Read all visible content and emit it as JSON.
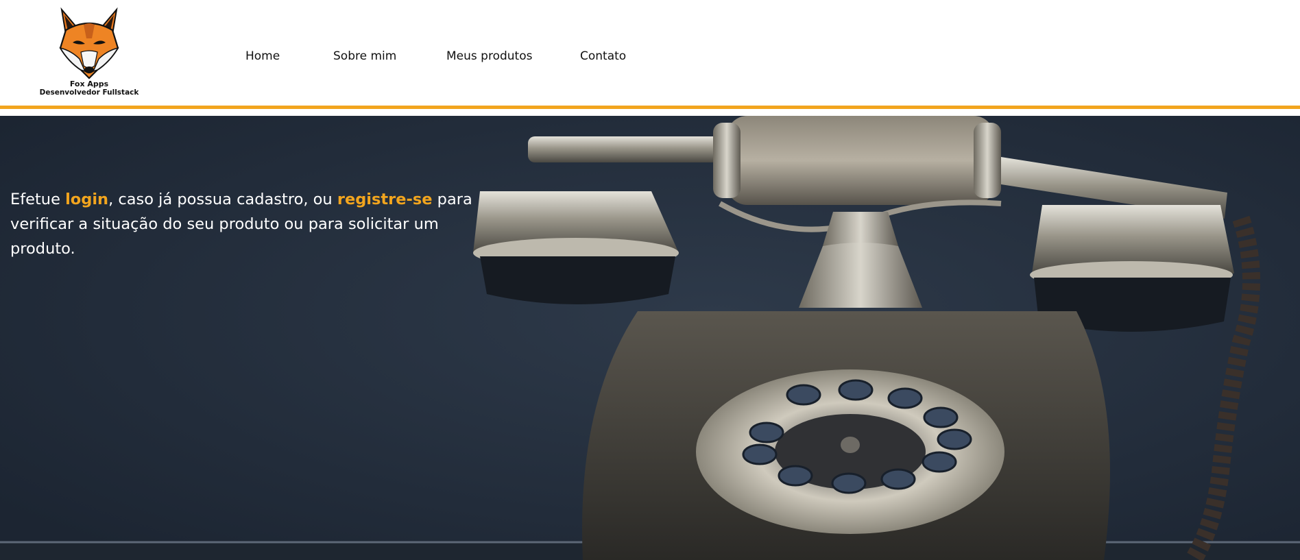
{
  "brand": {
    "name": "Fox Apps",
    "subtitle": "Desenvolvedor Fullstack",
    "logo_icon": "fox-head-icon"
  },
  "nav": {
    "items": [
      {
        "label": "Home"
      },
      {
        "label": "Sobre mim"
      },
      {
        "label": "Meus produtos"
      },
      {
        "label": "Contato"
      }
    ]
  },
  "hero": {
    "text_part1": "Efetue ",
    "login_link": "login",
    "text_part2": ", caso já possua cadastro, ou ",
    "register_link": "registre-se",
    "text_part3": " para verificar a situação do seu produto ou para solicitar um produto.",
    "background_image": "vintage-rotary-telephone-photo"
  },
  "colors": {
    "accent": "#f2a51e",
    "hero_background": "#222d3b",
    "text": "#ffffff"
  }
}
